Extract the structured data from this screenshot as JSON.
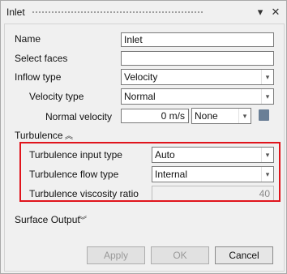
{
  "window": {
    "title": "Inlet"
  },
  "form": {
    "name_label": "Name",
    "name_value": "Inlet",
    "select_faces_label": "Select faces",
    "select_faces_value": "",
    "inflow_type_label": "Inflow type",
    "inflow_type_value": "Velocity",
    "velocity_type_label": "Velocity type",
    "velocity_type_value": "Normal",
    "normal_velocity_label": "Normal velocity",
    "normal_velocity_value": "0 m/s",
    "normal_velocity_unit_select": "None"
  },
  "turbulence": {
    "section_label": "Turbulence",
    "input_type_label": "Turbulence input type",
    "input_type_value": "Auto",
    "flow_type_label": "Turbulence flow type",
    "flow_type_value": "Internal",
    "viscosity_ratio_label": "Turbulence viscosity ratio",
    "viscosity_ratio_value": "40"
  },
  "surface_output": {
    "section_label": "Surface Output"
  },
  "buttons": {
    "apply_label": "Apply",
    "ok_label": "OK",
    "cancel_label": "Cancel"
  },
  "icons": {
    "close": "close-icon",
    "dock": "chevron-down-icon",
    "collapse": "chevron-up-double-icon",
    "expand": "chevron-down-double-icon",
    "unit_picker": "unit-picker-icon"
  }
}
